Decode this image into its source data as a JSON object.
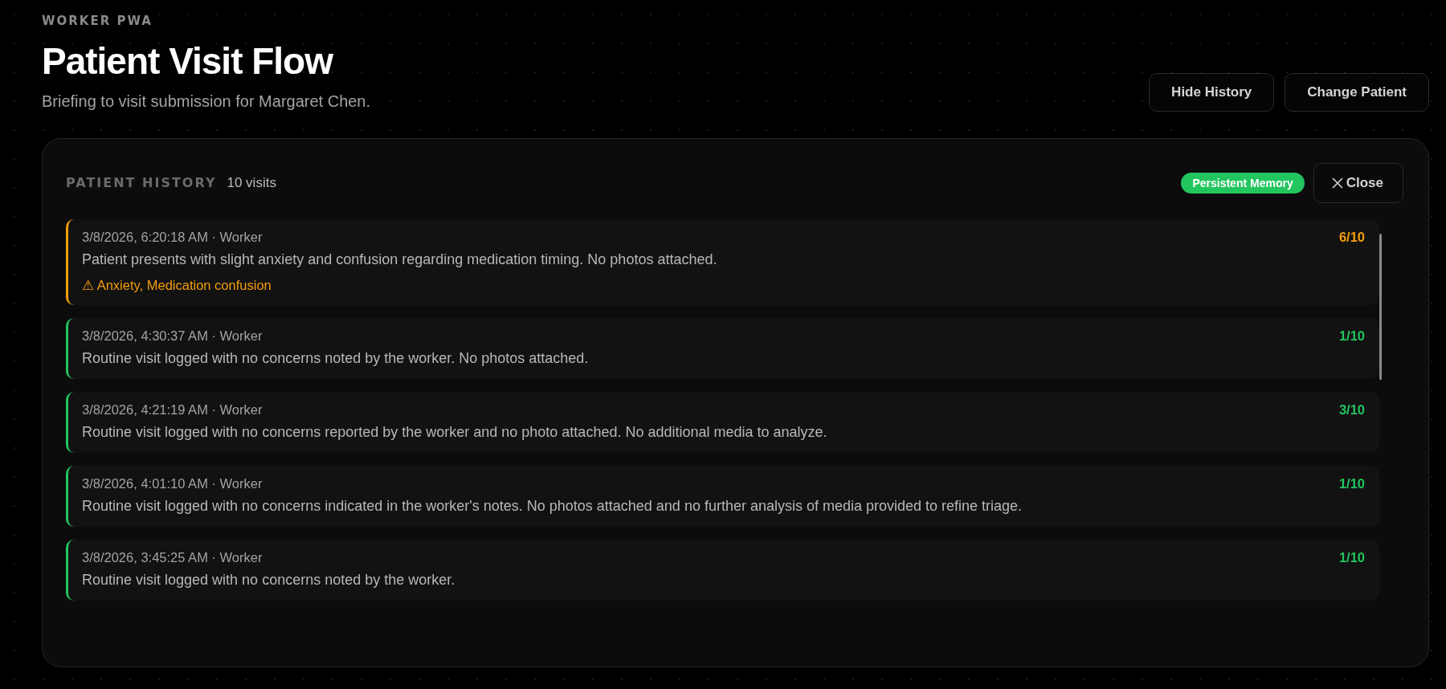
{
  "header": {
    "eyebrow": "WORKER PWA",
    "title": "Patient Visit Flow",
    "subtitle": "Briefing to visit submission for Margaret Chen."
  },
  "buttons": [
    "Hide History",
    "Change Patient"
  ],
  "history": {
    "title": "PATIENT HISTORY",
    "count": "10 visits",
    "badge": "Persistent Memory",
    "close_label": "Close",
    "visits": [
      {
        "meta": "3/8/2026, 6:20:18 AM · Worker",
        "score": "6/10",
        "color": "#f59e0b",
        "note": "Patient presents with slight anxiety and confusion regarding medication timing. No photos attached.",
        "alert": "⚠ Anxiety, Medication confusion"
      },
      {
        "meta": "3/8/2026, 4:30:37 AM · Worker",
        "score": "1/10",
        "color": "#22c55e",
        "note": "Routine visit logged with no concerns noted by the worker. No photos attached."
      },
      {
        "meta": "3/8/2026, 4:21:19 AM · Worker",
        "score": "3/10",
        "color": "#22c55e",
        "note": "Routine visit logged with no concerns reported by the worker and no photo attached. No additional media to analyze."
      },
      {
        "meta": "3/8/2026, 4:01:10 AM · Worker",
        "score": "1/10",
        "color": "#22c55e",
        "note": "Routine visit logged with no concerns indicated in the worker's notes. No photos attached and no further analysis of media provided to refine triage."
      },
      {
        "meta": "3/8/2026, 3:45:25 AM · Worker",
        "score": "1/10",
        "color": "#22c55e",
        "note": "Routine visit logged with no concerns noted by the worker."
      }
    ]
  }
}
